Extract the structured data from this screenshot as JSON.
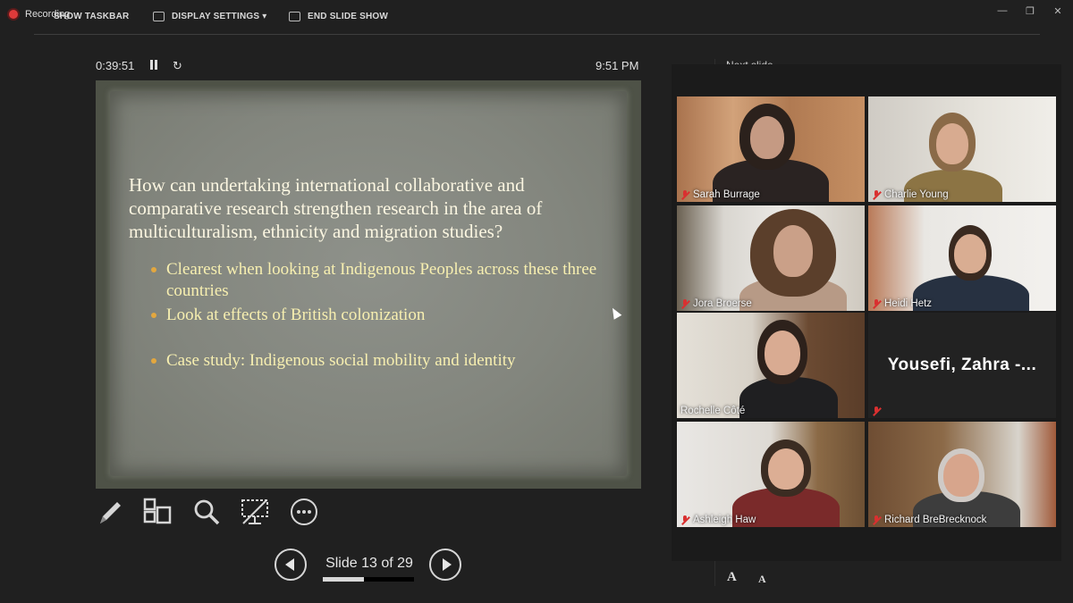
{
  "toolbar": {
    "recording_label": "Recording",
    "show_taskbar": "SHOW TASKBAR",
    "display_settings": "DISPLAY SETTINGS ▾",
    "end_slide_show": "END SLIDE SHOW",
    "minimize_glyph": "—",
    "restore_glyph": "❐",
    "close_glyph": "✕"
  },
  "presenter": {
    "elapsed": "0:39:51",
    "clock": "9:51 PM",
    "reload_glyph": "↻",
    "next_slide_label": "Next slide"
  },
  "slide": {
    "question": "How can undertaking international collaborative and comparative research strengthen research in the area of multiculturalism, ethnicity and migration studies?",
    "bullets": [
      "Clearest when looking at Indigenous Peoples across these three countries",
      "Look at effects of British colonization",
      "Case study: Indigenous social mobility and identity"
    ]
  },
  "navigation": {
    "slide_counter": "Slide 13 of 29",
    "current_slide": 13,
    "total_slides": 29
  },
  "participants": [
    {
      "name": "Sarah Burrage",
      "muted": true
    },
    {
      "name": "Charlie Young",
      "muted": true
    },
    {
      "name": "Jora Broerse",
      "muted": true
    },
    {
      "name": "Heidi Hetz",
      "muted": true
    },
    {
      "name": "Rochelle Côté",
      "muted": false,
      "active_speaker": true
    },
    {
      "name": "Yousefi, Zahra -...",
      "muted": true,
      "video": false
    },
    {
      "name": "Ashleigh Haw",
      "muted": true
    },
    {
      "name": "Richard BreBrecknock",
      "muted": true
    }
  ],
  "font_controls": {
    "increase": "A",
    "decrease": "A"
  },
  "colors": {
    "background": "#202020",
    "slide_text": "#fbf6e1",
    "bullet_text": "#f7efb0",
    "bullet_marker": "#e3a73f",
    "active_speaker_border": "#d8e07a",
    "muted_icon": "#d93030"
  }
}
